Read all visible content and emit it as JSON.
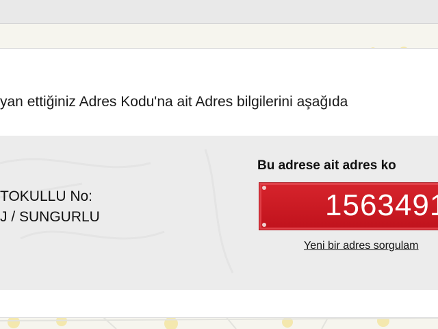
{
  "colors": {
    "code_box_red": "#c8151d",
    "panel_bg": "#ffffff",
    "info_area_bg": "#ececec"
  },
  "info_text": "yan ettiğiniz Adres Kodu'na ait Adres bilgilerini aşağıda",
  "address": {
    "line1": "TOKULLU No:",
    "line2": "J / SUNGURLU"
  },
  "code_section": {
    "heading": "Bu adrese ait adres ko",
    "code": "1563491",
    "link_label": "Yeni bir adres sorgulam"
  }
}
